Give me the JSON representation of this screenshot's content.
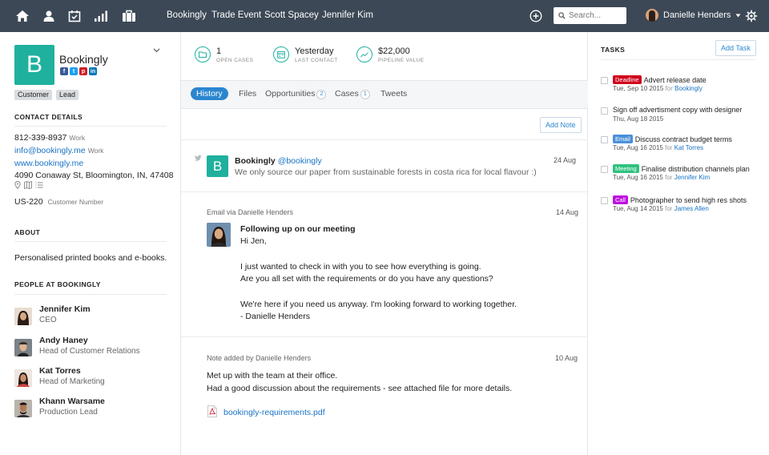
{
  "topbar": {
    "crumbs": [
      "Bookingly",
      "Trade Event",
      "Scott Spacey",
      "Jennifer Kim"
    ],
    "search_placeholder": "Search...",
    "user_name": "Danielle Henders"
  },
  "contact": {
    "logo_letter": "B",
    "name": "Bookingly",
    "tags": [
      "Customer",
      "Lead"
    ],
    "details_heading": "CONTACT DETAILS",
    "phone": "812-339-8937",
    "phone_type": "Work",
    "email": "info@bookingly.me",
    "email_type": "Work",
    "website": "www.bookingly.me",
    "address": "4090 Conaway St, Bloomington, IN, 47408",
    "customer_number": "US-220",
    "customer_number_label": "Customer Number",
    "about_heading": "ABOUT",
    "about": "Personalised printed books and e-books.",
    "people_heading": "PEOPLE AT BOOKINGLY",
    "people": [
      {
        "name": "Jennifer Kim",
        "role": "CEO"
      },
      {
        "name": "Andy Haney",
        "role": "Head of Customer Relations"
      },
      {
        "name": "Kat Torres",
        "role": "Head of Marketing"
      },
      {
        "name": "Khann Warsame",
        "role": "Production Lead"
      }
    ]
  },
  "stats": [
    {
      "value": "1",
      "label": "OPEN CASES",
      "icon": "folder-icon"
    },
    {
      "value": "Yesterday",
      "label": "LAST CONTACT",
      "icon": "calendar-icon"
    },
    {
      "value": "$22,000",
      "label": "PIPELINE VALUE",
      "icon": "trend-icon"
    }
  ],
  "tabs": [
    {
      "label": "History"
    },
    {
      "label": "Files"
    },
    {
      "label": "Opportunities",
      "count": "2"
    },
    {
      "label": "Cases",
      "count": "1"
    },
    {
      "label": "Tweets"
    }
  ],
  "add_note_label": "Add Note",
  "history": {
    "tweet": {
      "logo_letter": "B",
      "author": "Bookingly",
      "handle": "@bookingly",
      "text": "We only source our paper from sustainable forests in costa rica for local flavour :)",
      "date": "24 Aug"
    },
    "email": {
      "meta": "Email via Danielle Henders",
      "date": "14 Aug",
      "subject": "Following up on our meeting",
      "lines": [
        "Hi Jen,",
        "I just wanted to check in with you to see how everything is going.",
        "Are you all set with the requirements or do you have any questions?",
        "We're here if you need us anyway. I'm looking forward to working together.",
        "- Danielle Henders"
      ]
    },
    "note": {
      "meta": "Note added by Danielle Henders",
      "date": "10 Aug",
      "lines": [
        "Met up with the team at their office.",
        "Had a good discussion about the requirements - see attached file for more details."
      ],
      "attachment": "bookingly-requirements.pdf"
    }
  },
  "tasks": {
    "heading": "TASKS",
    "add_label": "Add Task",
    "for_word": "for",
    "items": [
      {
        "badge": "Deadline",
        "badge_color": "#d0021b",
        "title": "Advert release date",
        "date": "Tue, Sep 10 2015",
        "for": "Bookingly"
      },
      {
        "badge": "",
        "badge_color": "",
        "title": "Sign off advertisment copy with designer",
        "date": "Thu, Aug 18 2015",
        "for": ""
      },
      {
        "badge": "Email",
        "badge_color": "#4a90d9",
        "title": "Discuss contract budget terms",
        "date": "Tue, Aug 16 2015",
        "for": "Kat Torres"
      },
      {
        "badge": "Meeting",
        "badge_color": "#2ec27e",
        "title": "Finalise distribution channels plan",
        "date": "Tue, Aug 16 2015",
        "for": "Jennifer Kim"
      },
      {
        "badge": "Call",
        "badge_color": "#bd10e0",
        "title": "Photographer to send high res shots",
        "date": "Tue, Aug 14 2015",
        "for": "James Allen"
      }
    ]
  }
}
